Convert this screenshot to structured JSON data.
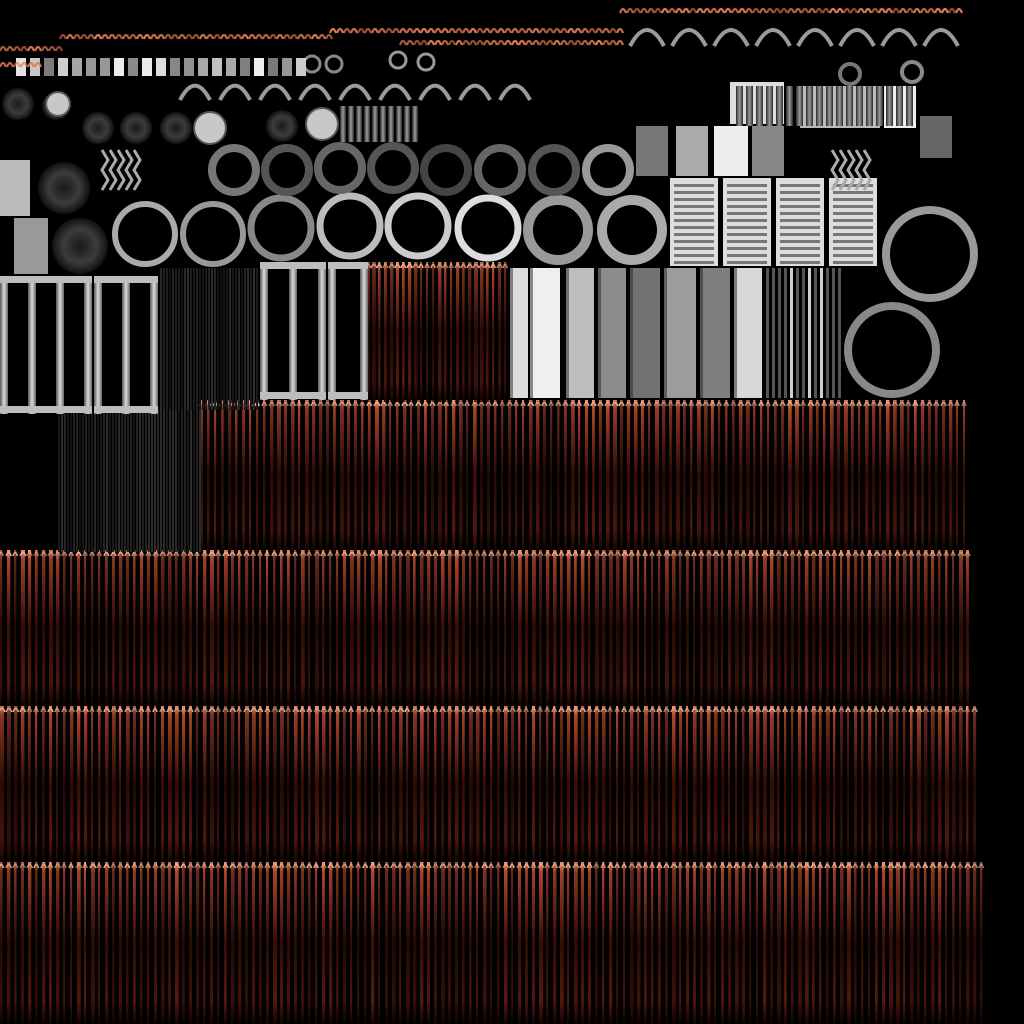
{
  "texture_atlas": {
    "background": "#000000",
    "palette": {
      "copper": "#e07a55",
      "copper_light": "#f3b08f",
      "copper_dark": "#3a0d05",
      "metal_light": "#e6e6e6",
      "metal_mid": "#8a8a8a",
      "metal_dark": "#3a3a3a"
    },
    "regions": [
      {
        "name": "small-parts",
        "icon": "gear-icon"
      },
      {
        "name": "rings",
        "icon": "ring-icon"
      },
      {
        "name": "ladder-frames",
        "icon": "ladder-icon"
      },
      {
        "name": "plates",
        "icon": "plate-icon"
      },
      {
        "name": "copper-wire-bands",
        "icon": "wire-icon"
      }
    ]
  }
}
